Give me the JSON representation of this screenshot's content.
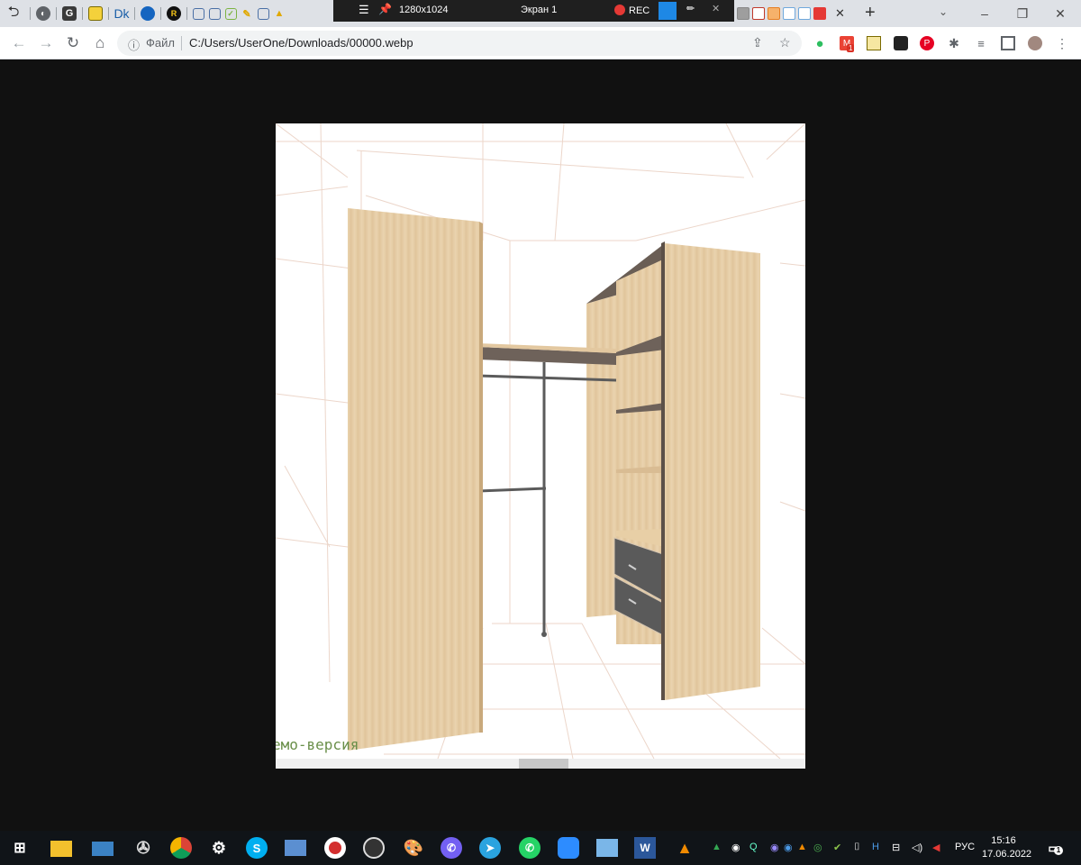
{
  "tabstrip": {
    "recorder": {
      "resolution": "1280x1024",
      "screen": "Экран 1",
      "rec_label": "REC"
    },
    "favicons": [
      "G",
      "Dk",
      "R"
    ],
    "active_tab_close": "✕",
    "new_tab": "+",
    "window_controls": {
      "minimize": "–",
      "restore": "❐",
      "close": "✕"
    }
  },
  "toolbar": {
    "file_label": "Файл",
    "url": "C:/Users/UserOne/Downloads/00000.webp",
    "gmail_badge": "1"
  },
  "viewer": {
    "watermark": "емо-версия"
  },
  "taskbar": {
    "language": "РУС",
    "time": "15:16",
    "date": "17.06.2022",
    "notifications_badge": "1",
    "word_letter": "W",
    "skype_letter": "S"
  },
  "colors": {
    "wood": "#e7cea8",
    "wood_dark": "#d9bc93",
    "shelf_top": "#6e625a",
    "rod": "#5b5b5b",
    "drawer": "#5a5a5a",
    "grid": "#ead3c7"
  }
}
